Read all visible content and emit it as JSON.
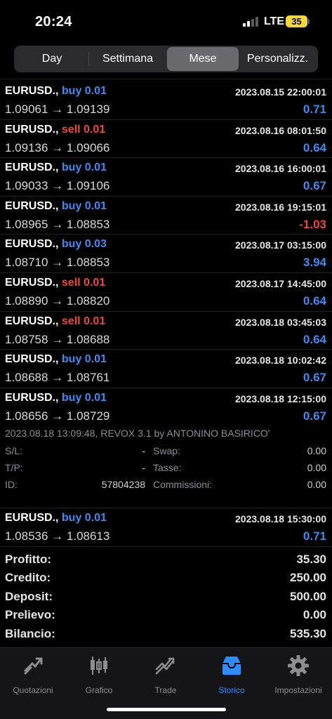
{
  "status_bar": {
    "time": "20:24",
    "network": "LTE",
    "battery": "35"
  },
  "period_tabs": [
    {
      "label": "Day",
      "active": false
    },
    {
      "label": "Settimana",
      "active": false
    },
    {
      "label": "Mese",
      "active": true
    },
    {
      "label": "Personalizz.",
      "active": false
    }
  ],
  "deals": [
    {
      "symbol": "EURUSD.,",
      "type": "buy 0.01",
      "side": "buy",
      "datetime": "2023.08.15 22:00:01",
      "prices": "1.09061 → 1.09139",
      "profit": "0.71"
    },
    {
      "symbol": "EURUSD.,",
      "type": "sell 0.01",
      "side": "sell",
      "datetime": "2023.08.16 08:01:50",
      "prices": "1.09136 → 1.09066",
      "profit": "0.64"
    },
    {
      "symbol": "EURUSD.,",
      "type": "buy 0.01",
      "side": "buy",
      "datetime": "2023.08.16 16:00:01",
      "prices": "1.09033 → 1.09106",
      "profit": "0.67"
    },
    {
      "symbol": "EURUSD.,",
      "type": "buy 0.01",
      "side": "buy",
      "datetime": "2023.08.16 19:15:01",
      "prices": "1.08965 → 1.08853",
      "profit": "-1.03"
    },
    {
      "symbol": "EURUSD.,",
      "type": "buy 0.03",
      "side": "buy",
      "datetime": "2023.08.17 03:15:00",
      "prices": "1.08710 → 1.08853",
      "profit": "3.94"
    },
    {
      "symbol": "EURUSD.,",
      "type": "sell 0.01",
      "side": "sell",
      "datetime": "2023.08.17 14:45:00",
      "prices": "1.08890 → 1.08820",
      "profit": "0.64"
    },
    {
      "symbol": "EURUSD.,",
      "type": "sell 0.01",
      "side": "sell",
      "datetime": "2023.08.18 03:45:03",
      "prices": "1.08758 → 1.08688",
      "profit": "0.64"
    },
    {
      "symbol": "EURUSD.,",
      "type": "buy 0.01",
      "side": "buy",
      "datetime": "2023.08.18 10:02:42",
      "prices": "1.08688 → 1.08761",
      "profit": "0.67"
    },
    {
      "symbol": "EURUSD.,",
      "type": "buy 0.01",
      "side": "buy",
      "datetime": "2023.08.18 12:15:00",
      "prices": "1.08656 → 1.08729",
      "profit": "0.67"
    }
  ],
  "expanded": {
    "comment": "2023.08.18 13:09:48, REVOX 3.1 by ANTONINO BASIRICO'",
    "sl_label": "S/L:",
    "sl_value": "-",
    "tp_label": "T/P:",
    "tp_value": "-",
    "id_label": "ID:",
    "id_value": "57804238",
    "swap_label": "Swap:",
    "swap_value": "0.00",
    "tasse_label": "Tasse:",
    "tasse_value": "0.00",
    "commissioni_label": "Commissioni:",
    "commissioni_value": "0.00"
  },
  "last_deal": {
    "symbol": "EURUSD.,",
    "type": "buy 0.01",
    "side": "buy",
    "datetime": "2023.08.18 15:30:00",
    "prices": "1.08536 → 1.08613",
    "profit": "0.71"
  },
  "summary": [
    {
      "label": "Profitto:",
      "value": "35.30"
    },
    {
      "label": "Credito:",
      "value": "250.00"
    },
    {
      "label": "Deposit:",
      "value": "500.00"
    },
    {
      "label": "Prelievo:",
      "value": "0.00"
    },
    {
      "label": "Bilancio:",
      "value": "535.30"
    }
  ],
  "tabbar": [
    {
      "label": "Quotazioni",
      "icon": "quotes-icon",
      "active": false
    },
    {
      "label": "Grafico",
      "icon": "chart-icon",
      "active": false
    },
    {
      "label": "Trade",
      "icon": "trade-icon",
      "active": false
    },
    {
      "label": "Storico",
      "icon": "history-icon",
      "active": true
    },
    {
      "label": "Impostazioni",
      "icon": "settings-icon",
      "active": false
    }
  ],
  "colors": {
    "buy": "#3b8cf0",
    "sell": "#ef4538",
    "accent": "#2f8cff",
    "battery": "#f4d83a"
  }
}
